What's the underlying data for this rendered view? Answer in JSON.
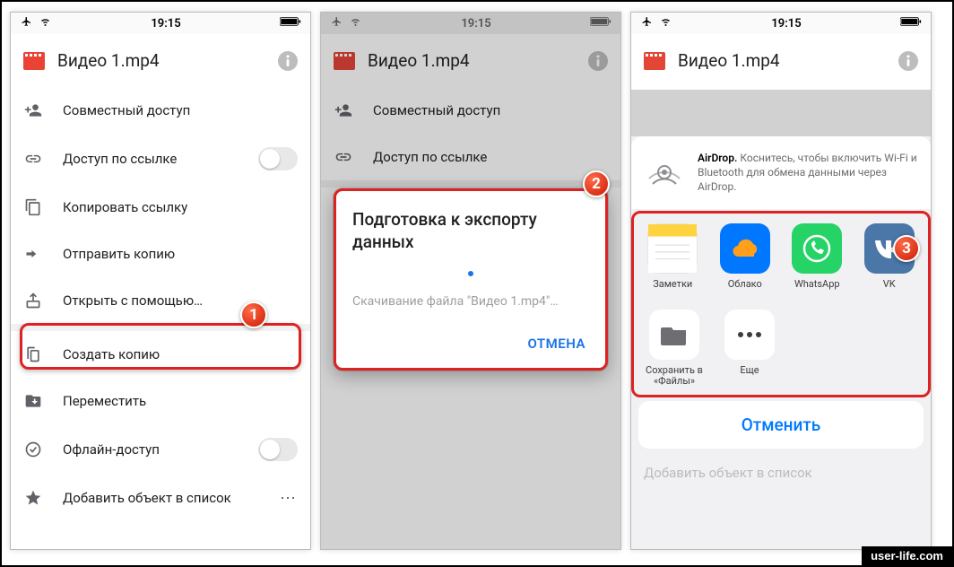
{
  "status": {
    "time": "19:15"
  },
  "file": {
    "name": "Видео 1.mp4"
  },
  "menu": {
    "share": "Совместный доступ",
    "link_access": "Доступ по ссылке",
    "copy_link": "Копировать ссылку",
    "send_copy": "Отправить копию",
    "open_with": "Открыть с помощью…",
    "make_copy": "Создать копию",
    "move": "Переместить",
    "offline": "Офлайн-доступ",
    "add_to_list": "Добавить объект в список"
  },
  "dialog": {
    "title": "Подготовка к экспорту данных",
    "subtitle": "Скачивание файла \"Видео 1.mp4\"…",
    "cancel": "ОТМЕНА"
  },
  "airdrop": {
    "bold": "AirDrop.",
    "text": " Коснитесь, чтобы включить Wi-Fi и Bluetooth для обмена данными через AirDrop."
  },
  "apps": {
    "notes": "Заметки",
    "cloud": "Облако",
    "whatsapp": "WhatsApp",
    "vk": "VK"
  },
  "actions": {
    "save_files": "Сохранить в «Файлы»",
    "more": "Еще"
  },
  "sheet_cancel": "Отменить",
  "badges": {
    "b1": "1",
    "b2": "2",
    "b3": "3"
  },
  "watermark": "user-life.com"
}
